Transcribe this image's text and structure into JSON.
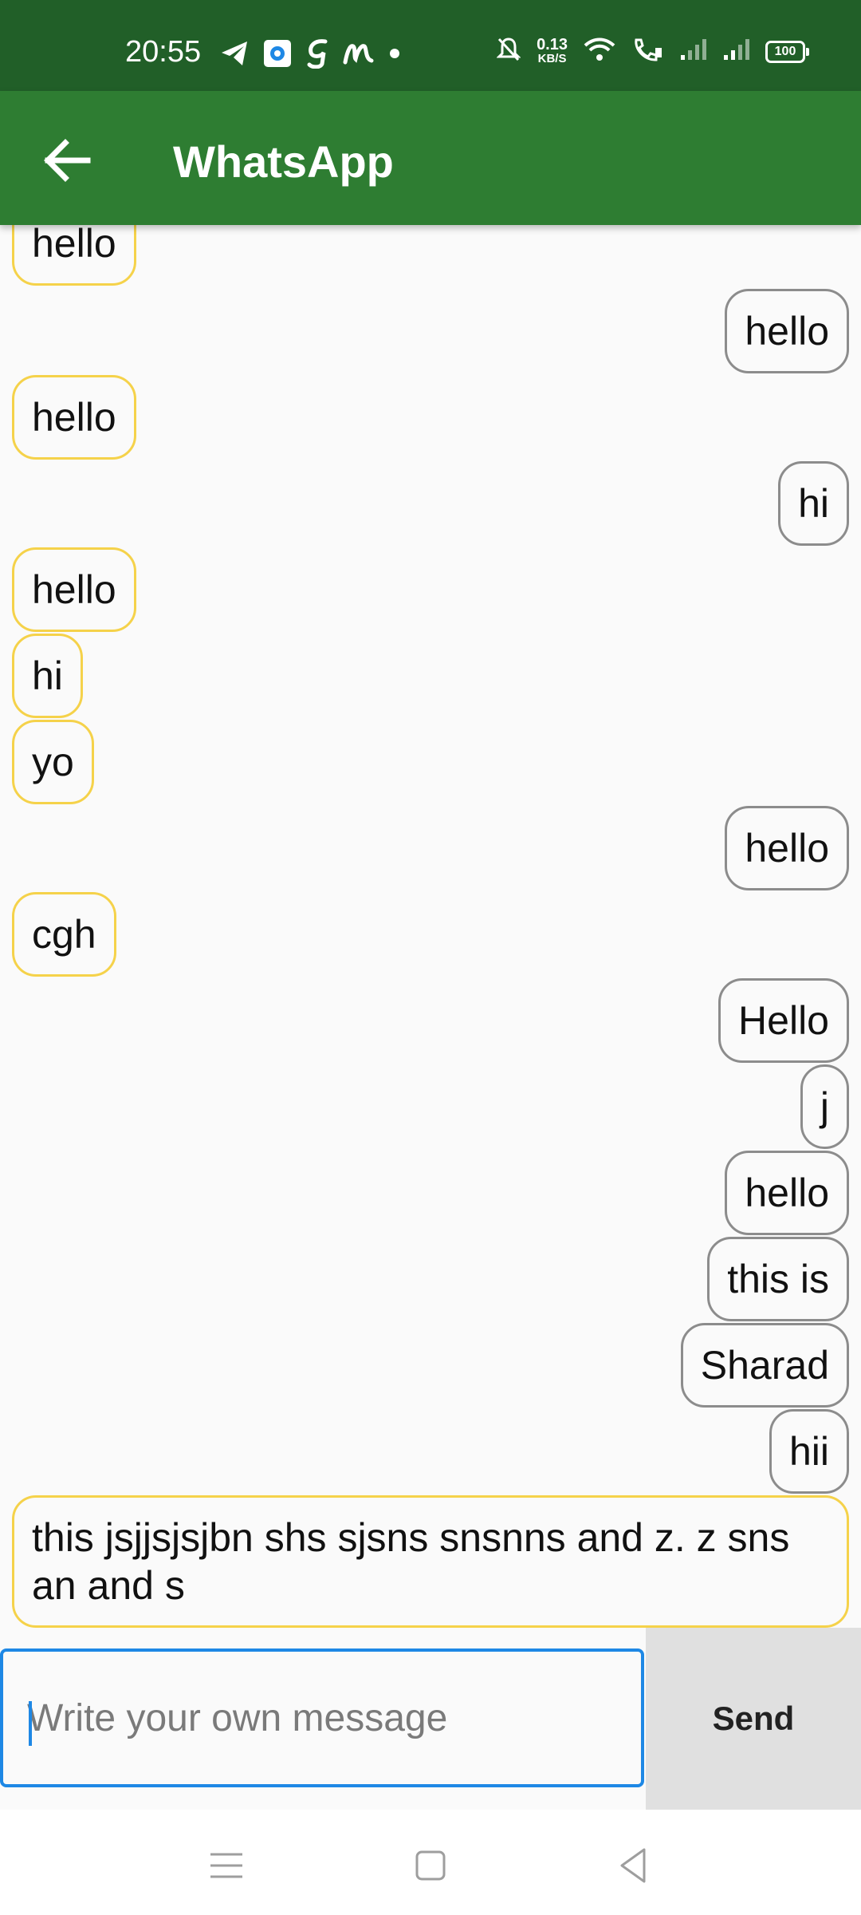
{
  "status_bar": {
    "time": "20:55",
    "net_speed_value": "0.13",
    "net_speed_unit": "KB/S",
    "battery": "100",
    "left_icons": [
      "telegram-icon",
      "app-icon",
      "g-icon",
      "m-icon",
      "dot-icon"
    ],
    "right_icons": [
      "mute-bell-icon",
      "wifi-icon",
      "wifi-calling-icon",
      "signal-icon",
      "signal-icon",
      "battery-icon"
    ]
  },
  "app_bar": {
    "title": "WhatsApp",
    "back_icon": "arrow-back-icon"
  },
  "messages": [
    {
      "side": "in",
      "text": "hello"
    },
    {
      "side": "out",
      "text": "hello"
    },
    {
      "side": "in",
      "text": "hello"
    },
    {
      "side": "out",
      "text": "hi"
    },
    {
      "side": "in",
      "text": "hello"
    },
    {
      "side": "in",
      "text": "hi"
    },
    {
      "side": "in",
      "text": "yo"
    },
    {
      "side": "out",
      "text": "hello"
    },
    {
      "side": "in",
      "text": "cgh"
    },
    {
      "side": "out",
      "text": "Hello"
    },
    {
      "side": "out",
      "text": "j"
    },
    {
      "side": "out",
      "text": "hello"
    },
    {
      "side": "out",
      "text": "this is"
    },
    {
      "side": "out",
      "text": "Sharad"
    },
    {
      "side": "out",
      "text": "hii"
    },
    {
      "side": "in",
      "text": "this jsjjsjsjbn shs sjsns snsnns and z. z sns an and s"
    }
  ],
  "composer": {
    "placeholder": "Write your own message",
    "value": "",
    "send_label": "Send"
  },
  "nav_bar": {
    "icons": [
      "menu-icon",
      "home-icon",
      "back-icon"
    ]
  },
  "colors": {
    "status_bar": "#215f28",
    "app_bar": "#2e7d32",
    "incoming_border": "#f5d24a",
    "outgoing_border": "#8c8c8c",
    "input_border": "#1e88e5",
    "send_bg": "#e0e0e0"
  }
}
